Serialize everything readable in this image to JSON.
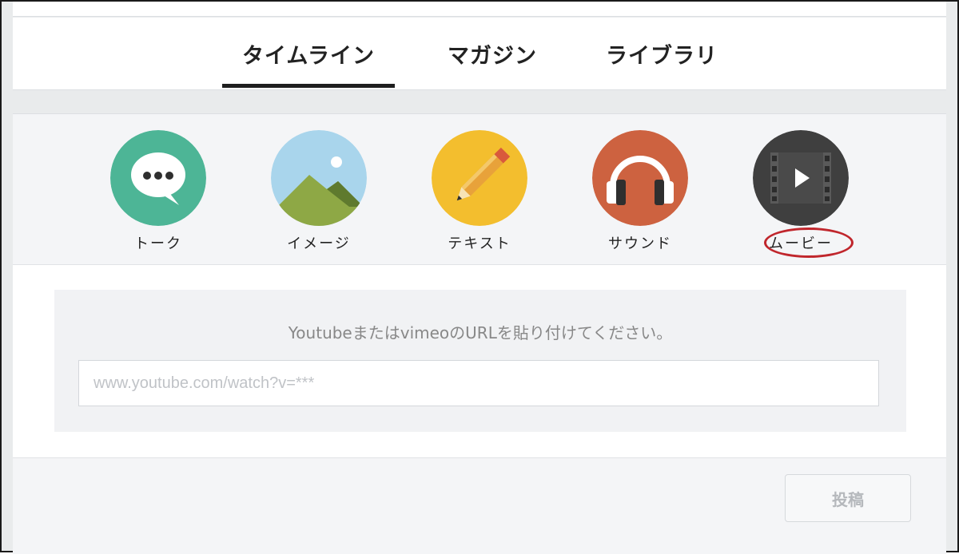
{
  "tabs": [
    {
      "label": "タイムライン",
      "active": true
    },
    {
      "label": "マガジン",
      "active": false
    },
    {
      "label": "ライブラリ",
      "active": false
    }
  ],
  "post_types": [
    {
      "label": "トーク",
      "icon": "speech-bubble-icon",
      "color": "#4db596"
    },
    {
      "label": "イメージ",
      "icon": "mountain-image-icon",
      "color": "#a9d5ec"
    },
    {
      "label": "テキスト",
      "icon": "pencil-icon",
      "color": "#f3be2e"
    },
    {
      "label": "サウンド",
      "icon": "headphones-icon",
      "color": "#cd6240"
    },
    {
      "label": "ムービー",
      "icon": "film-play-icon",
      "color": "#3f3f3f",
      "highlighted": true
    }
  ],
  "movie_form": {
    "prompt": "YoutubeまたはvimeoのURLを貼り付けてください。",
    "placeholder": "www.youtube.com/watch?v=***",
    "value": ""
  },
  "footer": {
    "post_button_label": "投稿"
  },
  "colors": {
    "highlight_ring": "#c0262c",
    "active_tab_underline": "#1e1e1e"
  }
}
